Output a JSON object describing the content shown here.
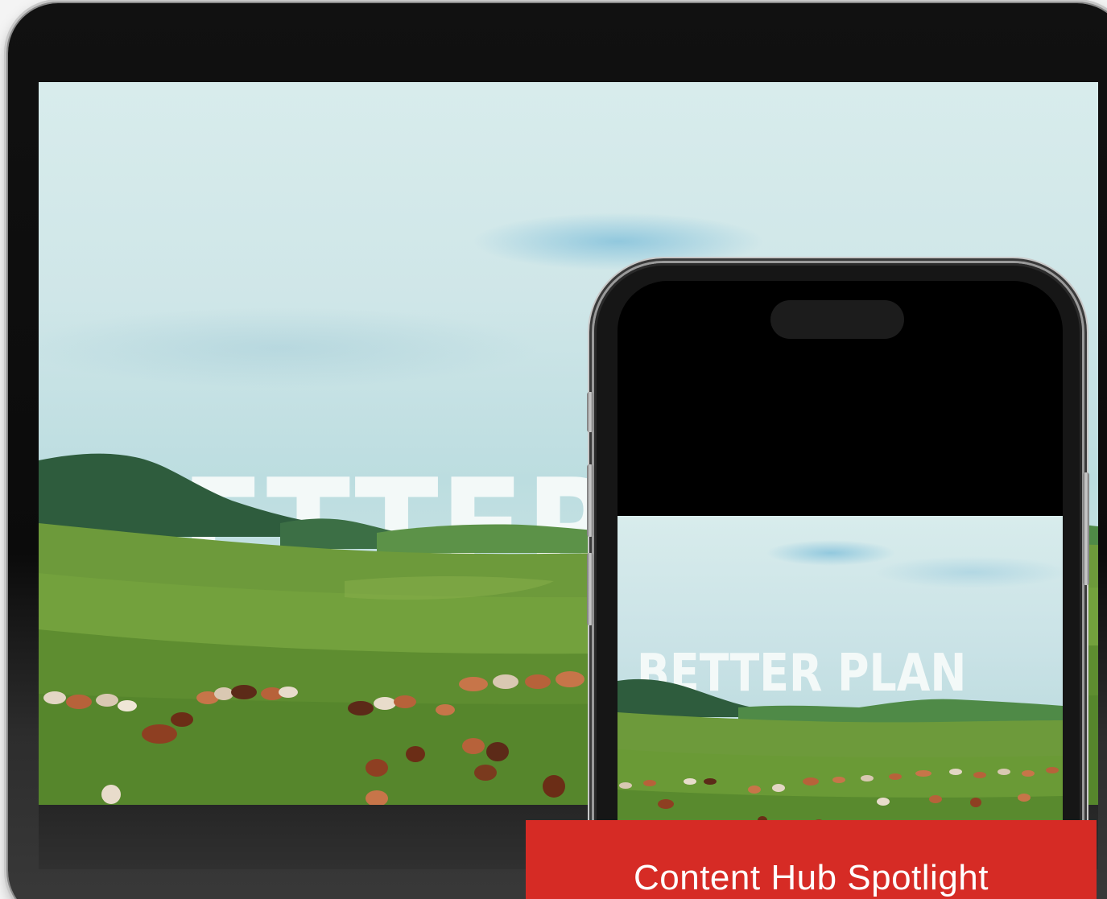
{
  "tablet": {
    "video": {
      "headline": "BETTER PLAN"
    }
  },
  "phone": {
    "video": {
      "headline": "BETTER PLAN"
    }
  },
  "banner": {
    "title": "Content Hub Spotlight",
    "color": "#d62b25"
  },
  "icons": [
    "cattle-pasture-scene"
  ]
}
